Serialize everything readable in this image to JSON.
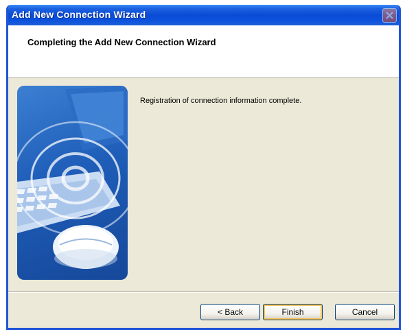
{
  "window": {
    "title": "Add New Connection Wizard",
    "close_icon": "close-icon"
  },
  "header": {
    "title": "Completing the Add New Connection Wizard"
  },
  "content": {
    "message": "Registration of connection information complete.",
    "illustration_icon": "wireless-keyboard-mouse-illustration"
  },
  "buttons": {
    "back": "< Back",
    "finish": "Finish",
    "cancel": "Cancel"
  },
  "colors": {
    "titlebar": "#0a4bd6",
    "dialog_background": "#ece9d8",
    "default_button_highlight": "#f5c45c"
  }
}
